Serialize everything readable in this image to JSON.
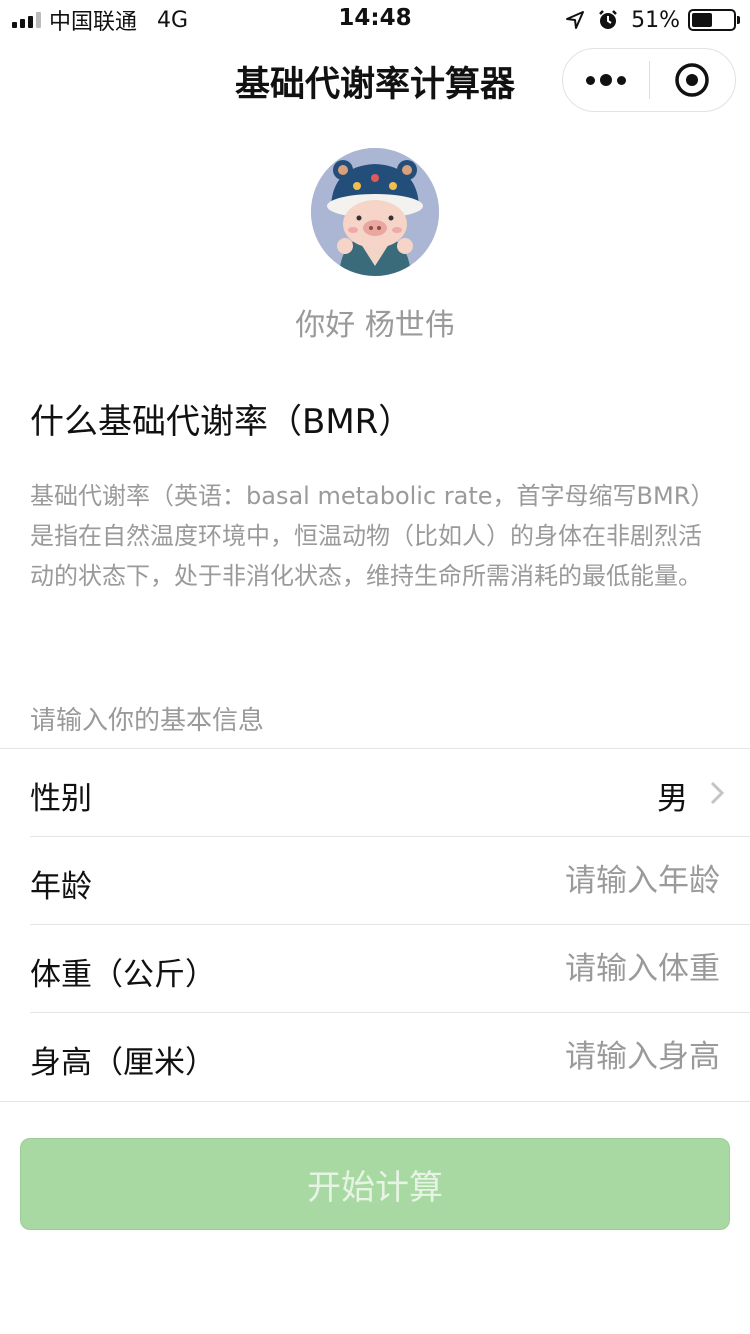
{
  "status_bar": {
    "carrier": "中国联通",
    "network": "4G",
    "time": "14:48",
    "battery_percent": "51%",
    "battery_level": 0.51
  },
  "nav": {
    "title": "基础代谢率计算器"
  },
  "user": {
    "greeting": "你好 杨世伟"
  },
  "description": {
    "title": "什么基础代谢率（BMR）",
    "body": "基础代谢率（英语：basal metabolic rate，首字母缩写BMR）是指在自然温度环境中，恒温动物（比如人）的身体在非剧烈活动的状态下，处于非消化状态，维持生命所需消耗的最低能量。"
  },
  "form": {
    "section_label": "请输入你的基本信息",
    "gender": {
      "label": "性别",
      "value": "男"
    },
    "age": {
      "label": "年龄",
      "placeholder": "请输入年龄"
    },
    "weight": {
      "label": "体重（公斤）",
      "placeholder": "请输入体重"
    },
    "height": {
      "label": "身高（厘米）",
      "placeholder": "请输入身高"
    }
  },
  "submit_label": "开始计算",
  "colors": {
    "button_bg": "#a9d9a3",
    "button_text": "#e6f4e3",
    "muted_text": "#9a9a9a"
  }
}
